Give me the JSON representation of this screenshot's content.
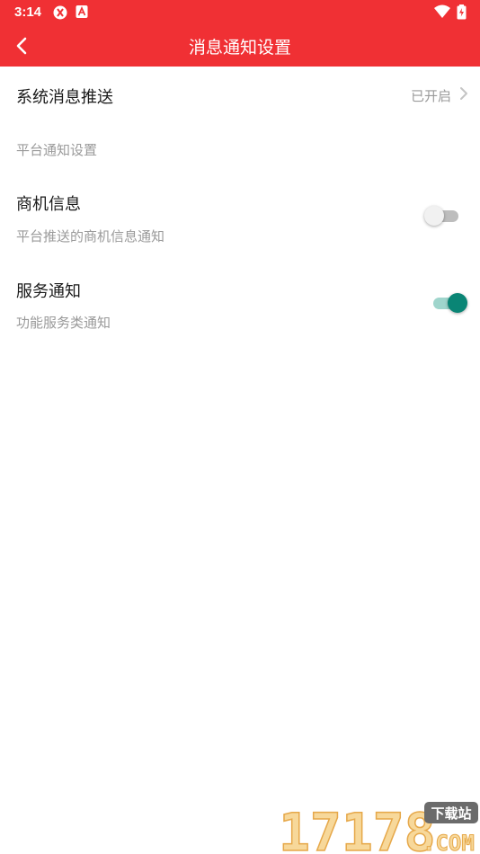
{
  "status_bar": {
    "time": "3:14",
    "icons": [
      "share-icon",
      "font-icon",
      "wifi-icon",
      "battery-charging-icon"
    ]
  },
  "app_bar": {
    "title": "消息通知设置",
    "back_icon": "chevron-left-icon"
  },
  "system_push": {
    "title": "系统消息推送",
    "status": "已开启",
    "icon": "chevron-right-icon"
  },
  "section": {
    "header": "平台通知设置"
  },
  "business_info": {
    "title": "商机信息",
    "subtitle": "平台推送的商机信息通知",
    "enabled": false
  },
  "service_notice": {
    "title": "服务通知",
    "subtitle": "功能服务类通知",
    "enabled": true
  },
  "colors": {
    "header_red": "#f03034",
    "toggle_on": "#0a8575",
    "toggle_on_track": "#9fd5cc",
    "toggle_off_track": "#bdbdbd"
  },
  "watermark": {
    "brand": "17178",
    "badge": "下载站",
    "domain": ".COM"
  }
}
